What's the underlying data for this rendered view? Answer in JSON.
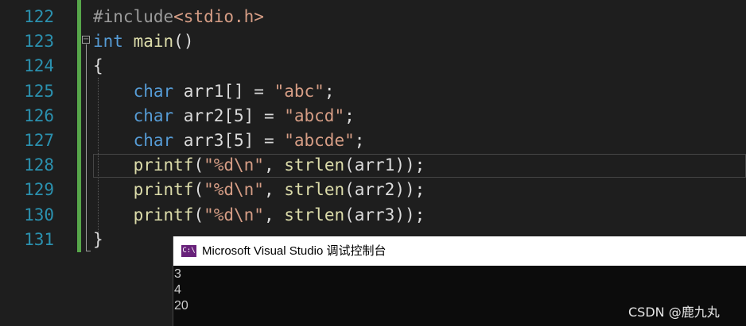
{
  "editor": {
    "lines": [
      {
        "num": "122",
        "parts": [
          {
            "t": "#include",
            "c": "pp"
          },
          {
            "t": "<stdio.h>",
            "c": "ppinc"
          }
        ]
      },
      {
        "num": "123",
        "parts": [
          {
            "t": "int",
            "c": "kw"
          },
          {
            "t": " ",
            "c": ""
          },
          {
            "t": "main",
            "c": "fn"
          },
          {
            "t": "()",
            "c": ""
          }
        ]
      },
      {
        "num": "124",
        "parts": [
          {
            "t": "{",
            "c": ""
          }
        ]
      },
      {
        "num": "125",
        "parts": [
          {
            "t": "    ",
            "c": ""
          },
          {
            "t": "char",
            "c": "kw"
          },
          {
            "t": " arr1[] = ",
            "c": "var"
          },
          {
            "t": "\"abc\"",
            "c": "str"
          },
          {
            "t": ";",
            "c": ""
          }
        ]
      },
      {
        "num": "126",
        "parts": [
          {
            "t": "    ",
            "c": ""
          },
          {
            "t": "char",
            "c": "kw"
          },
          {
            "t": " arr2[5] = ",
            "c": "var"
          },
          {
            "t": "\"abcd\"",
            "c": "str"
          },
          {
            "t": ";",
            "c": ""
          }
        ]
      },
      {
        "num": "127",
        "parts": [
          {
            "t": "    ",
            "c": ""
          },
          {
            "t": "char",
            "c": "kw"
          },
          {
            "t": " arr3[5] = ",
            "c": "var"
          },
          {
            "t": "\"abcde\"",
            "c": "str"
          },
          {
            "t": ";",
            "c": ""
          }
        ]
      },
      {
        "num": "128",
        "parts": [
          {
            "t": "    ",
            "c": ""
          },
          {
            "t": "printf",
            "c": "fn"
          },
          {
            "t": "(",
            "c": ""
          },
          {
            "t": "\"%d\\n\"",
            "c": "str"
          },
          {
            "t": ", ",
            "c": ""
          },
          {
            "t": "strlen",
            "c": "fn"
          },
          {
            "t": "(arr1));",
            "c": ""
          }
        ]
      },
      {
        "num": "129",
        "parts": [
          {
            "t": "    ",
            "c": ""
          },
          {
            "t": "printf",
            "c": "fn"
          },
          {
            "t": "(",
            "c": ""
          },
          {
            "t": "\"%d\\n\"",
            "c": "str"
          },
          {
            "t": ", ",
            "c": ""
          },
          {
            "t": "strlen",
            "c": "fn"
          },
          {
            "t": "(arr2));",
            "c": ""
          }
        ]
      },
      {
        "num": "130",
        "parts": [
          {
            "t": "    ",
            "c": ""
          },
          {
            "t": "printf",
            "c": "fn"
          },
          {
            "t": "(",
            "c": ""
          },
          {
            "t": "\"%d\\n\"",
            "c": "str"
          },
          {
            "t": ", ",
            "c": ""
          },
          {
            "t": "strlen",
            "c": "fn"
          },
          {
            "t": "(arr3));",
            "c": ""
          }
        ]
      },
      {
        "num": "131",
        "parts": [
          {
            "t": "}",
            "c": ""
          }
        ]
      }
    ],
    "collapse_glyph": "−"
  },
  "console": {
    "icon_text": "C:\\",
    "title": "Microsoft Visual Studio 调试控制台",
    "output": [
      "3",
      "4",
      "20"
    ]
  },
  "watermark": "CSDN @鹿九丸",
  "colors": {
    "background": "#1e1e1e",
    "keyword": "#569cd6",
    "string": "#d69d85",
    "function": "#dcdcaa",
    "line_number": "#2b91af",
    "change_bar": "#57a64a"
  }
}
